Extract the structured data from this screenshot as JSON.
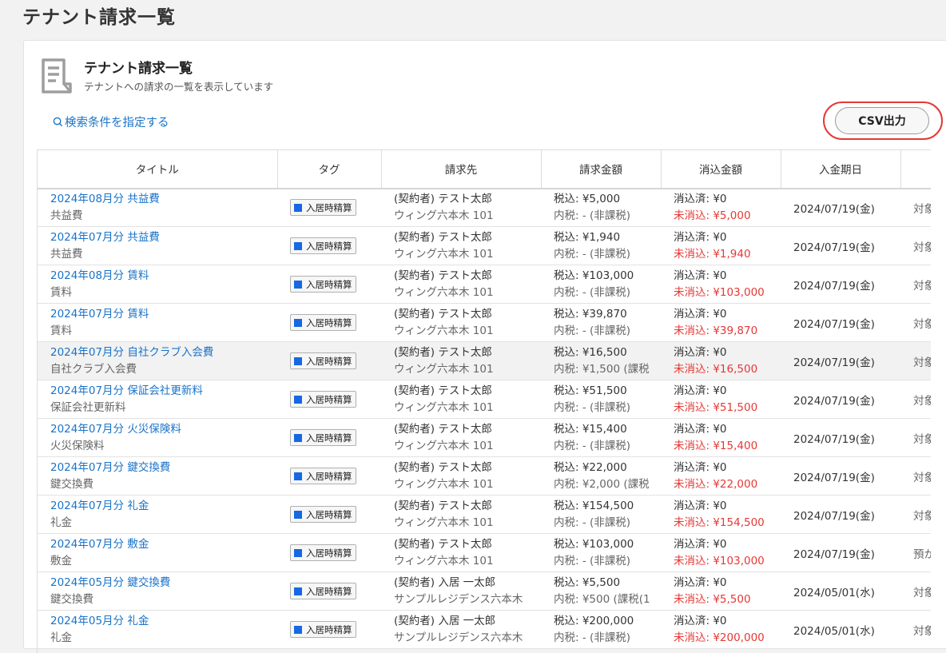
{
  "page": {
    "title": "テナント請求一覧"
  },
  "card": {
    "title": "テナント請求一覧",
    "subtitle": "テナントへの請求の一覧を表示しています",
    "search_link": "検索条件を指定する",
    "csv_button": "CSV出力"
  },
  "table": {
    "headers": [
      "タイトル",
      "タグ",
      "請求先",
      "請求金額",
      "消込金額",
      "入金期日",
      ""
    ],
    "rows": [
      {
        "title": "2024年08月分 共益費",
        "subtitle": "共益費",
        "tag": "入居時精算",
        "payer": "(契約者) テスト太郎",
        "property": "ウィング六本木 101",
        "amount": "税込: ¥5,000",
        "tax": "内税: - (非課税)",
        "cleared": "消込済: ¥0",
        "uncleared": "未消込: ¥5,000",
        "due": "2024/07/19(金)",
        "extra": "対象"
      },
      {
        "title": "2024年07月分 共益費",
        "subtitle": "共益費",
        "tag": "入居時精算",
        "payer": "(契約者) テスト太郎",
        "property": "ウィング六本木 101",
        "amount": "税込: ¥1,940",
        "tax": "内税: - (非課税)",
        "cleared": "消込済: ¥0",
        "uncleared": "未消込: ¥1,940",
        "due": "2024/07/19(金)",
        "extra": "対象"
      },
      {
        "title": "2024年08月分 賃料",
        "subtitle": "賃料",
        "tag": "入居時精算",
        "payer": "(契約者) テスト太郎",
        "property": "ウィング六本木 101",
        "amount": "税込: ¥103,000",
        "tax": "内税: - (非課税)",
        "cleared": "消込済: ¥0",
        "uncleared": "未消込: ¥103,000",
        "due": "2024/07/19(金)",
        "extra": "対象"
      },
      {
        "title": "2024年07月分 賃料",
        "subtitle": "賃料",
        "tag": "入居時精算",
        "payer": "(契約者) テスト太郎",
        "property": "ウィング六本木 101",
        "amount": "税込: ¥39,870",
        "tax": "内税: - (非課税)",
        "cleared": "消込済: ¥0",
        "uncleared": "未消込: ¥39,870",
        "due": "2024/07/19(金)",
        "extra": "対象"
      },
      {
        "title": "2024年07月分 自社クラブ入会費",
        "subtitle": "自社クラブ入会費",
        "tag": "入居時精算",
        "payer": "(契約者) テスト太郎",
        "property": "ウィング六本木 101",
        "amount": "税込: ¥16,500",
        "tax": "内税: ¥1,500 (課税",
        "cleared": "消込済: ¥0",
        "uncleared": "未消込: ¥16,500",
        "due": "2024/07/19(金)",
        "extra": "対象",
        "highlight": true
      },
      {
        "title": "2024年07月分 保証会社更新料",
        "subtitle": "保証会社更新料",
        "tag": "入居時精算",
        "payer": "(契約者) テスト太郎",
        "property": "ウィング六本木 101",
        "amount": "税込: ¥51,500",
        "tax": "内税: - (非課税)",
        "cleared": "消込済: ¥0",
        "uncleared": "未消込: ¥51,500",
        "due": "2024/07/19(金)",
        "extra": "対象"
      },
      {
        "title": "2024年07月分 火災保険料",
        "subtitle": "火災保険料",
        "tag": "入居時精算",
        "payer": "(契約者) テスト太郎",
        "property": "ウィング六本木 101",
        "amount": "税込: ¥15,400",
        "tax": "内税: - (非課税)",
        "cleared": "消込済: ¥0",
        "uncleared": "未消込: ¥15,400",
        "due": "2024/07/19(金)",
        "extra": "対象"
      },
      {
        "title": "2024年07月分 鍵交換費",
        "subtitle": "鍵交換費",
        "tag": "入居時精算",
        "payer": "(契約者) テスト太郎",
        "property": "ウィング六本木 101",
        "amount": "税込: ¥22,000",
        "tax": "内税: ¥2,000 (課税",
        "cleared": "消込済: ¥0",
        "uncleared": "未消込: ¥22,000",
        "due": "2024/07/19(金)",
        "extra": "対象"
      },
      {
        "title": "2024年07月分 礼金",
        "subtitle": "礼金",
        "tag": "入居時精算",
        "payer": "(契約者) テスト太郎",
        "property": "ウィング六本木 101",
        "amount": "税込: ¥154,500",
        "tax": "内税: - (非課税)",
        "cleared": "消込済: ¥0",
        "uncleared": "未消込: ¥154,500",
        "due": "2024/07/19(金)",
        "extra": "対象"
      },
      {
        "title": "2024年07月分 敷金",
        "subtitle": "敷金",
        "tag": "入居時精算",
        "payer": "(契約者) テスト太郎",
        "property": "ウィング六本木 101",
        "amount": "税込: ¥103,000",
        "tax": "内税: - (非課税)",
        "cleared": "消込済: ¥0",
        "uncleared": "未消込: ¥103,000",
        "due": "2024/07/19(金)",
        "extra": "預か"
      },
      {
        "title": "2024年05月分 鍵交換費",
        "subtitle": "鍵交換費",
        "tag": "入居時精算",
        "payer": "(契約者) 入居 一太郎",
        "property": "サンプルレジデンス六本木",
        "amount": "税込: ¥5,500",
        "tax": "内税: ¥500 (課税(1",
        "cleared": "消込済: ¥0",
        "uncleared": "未消込: ¥5,500",
        "due": "2024/05/01(水)",
        "extra": "対象"
      },
      {
        "title": "2024年05月分 礼金",
        "subtitle": "礼金",
        "tag": "入居時精算",
        "payer": "(契約者) 入居 一太郎",
        "property": "サンプルレジデンス六本木",
        "amount": "税込: ¥200,000",
        "tax": "内税: - (非課税)",
        "cleared": "消込済: ¥0",
        "uncleared": "未消込: ¥200,000",
        "due": "2024/05/01(水)",
        "extra": "対象"
      }
    ]
  },
  "colors": {
    "link": "#1a73c8",
    "uncleared": "#e53935",
    "tag_square": "#1668e3",
    "highlight_ring": "#e53935"
  }
}
